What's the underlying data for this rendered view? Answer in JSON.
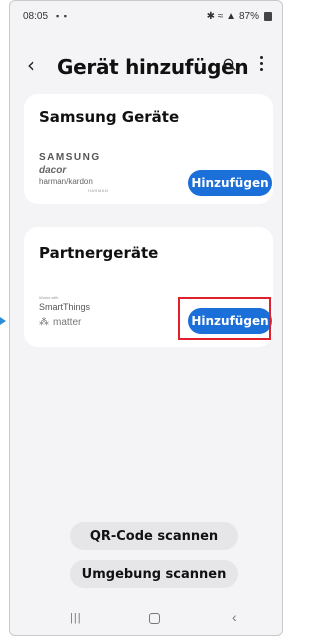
{
  "status_bar": {
    "time": "08:05",
    "left_icons": "▪ ▪",
    "right_icons": "✱ ≈ ▲",
    "battery_text": "87%"
  },
  "header": {
    "title": "Gerät hinzufügen",
    "back_icon": "‹"
  },
  "sections": [
    {
      "title": "Samsung Geräte",
      "brands": [
        "SAMSUNG",
        "dacor",
        "harman/kardon",
        "HARMAN"
      ],
      "button_label": "Hinzufügen"
    },
    {
      "title": "Partnergeräte",
      "brands": [
        "Works with",
        "SmartThings",
        "matter"
      ],
      "button_label": "Hinzufügen"
    }
  ],
  "actions": {
    "qr_label": "QR-Code scannen",
    "scan_label": "Umgebung scannen"
  },
  "nav": {
    "recents": "|||",
    "back": "‹"
  },
  "colors": {
    "accent": "#1b6fd8",
    "highlight": "#e0202a",
    "background": "#f4f4f6"
  }
}
